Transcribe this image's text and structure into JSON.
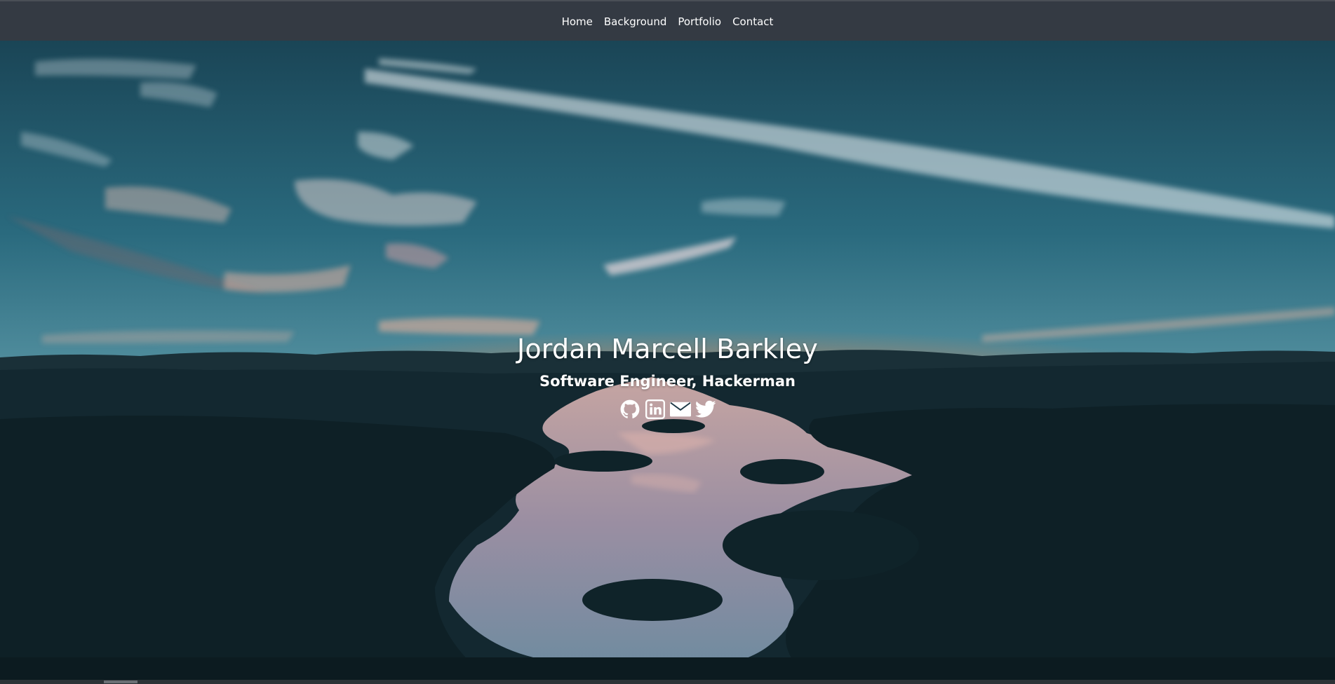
{
  "nav": {
    "links": [
      {
        "label": "Home"
      },
      {
        "label": "Background"
      },
      {
        "label": "Portfolio"
      },
      {
        "label": "Contact"
      }
    ]
  },
  "hero": {
    "name": "Jordan Marcell Barkley",
    "subtitle": "Software Engineer, Hackerman",
    "social": [
      {
        "icon": "github-icon"
      },
      {
        "icon": "linkedin-icon"
      },
      {
        "icon": "email-icon"
      },
      {
        "icon": "twitter-icon"
      }
    ]
  },
  "colors": {
    "navbar": "#343a43",
    "text": "#ffffff",
    "sky_top": "#1d4a5c",
    "sunset": "#f08a3c",
    "land": "#0f2228"
  }
}
